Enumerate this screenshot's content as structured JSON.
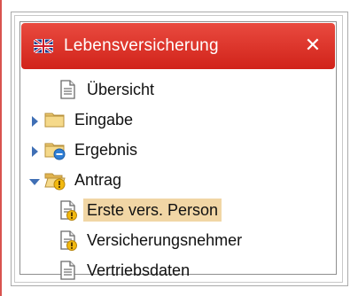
{
  "panel": {
    "title": "Lebensversicherung",
    "close_label": "✕",
    "header_color": "#d9281f",
    "icon": "flag-icon"
  },
  "tree": {
    "items": [
      {
        "label": "Übersicht",
        "icon": "document-icon",
        "level": 1,
        "expander": "none",
        "selected": false
      },
      {
        "label": "Eingabe",
        "icon": "folder-icon",
        "level": 0,
        "expander": "collapsed",
        "selected": false
      },
      {
        "label": "Ergebnis",
        "icon": "folder-info-icon",
        "level": 0,
        "expander": "collapsed",
        "selected": false
      },
      {
        "label": "Antrag",
        "icon": "folder-open-warning-icon",
        "level": 0,
        "expander": "expanded",
        "selected": false
      },
      {
        "label": "Erste vers. Person",
        "icon": "document-warning-icon",
        "level": 1,
        "expander": "none",
        "selected": true
      },
      {
        "label": "Versicherungsnehmer",
        "icon": "document-warning-icon",
        "level": 1,
        "expander": "none",
        "selected": false
      },
      {
        "label": "Vertriebsdaten",
        "icon": "document-icon",
        "level": 1,
        "expander": "none",
        "selected": false
      }
    ],
    "selected_color": "#f1d6a5"
  }
}
